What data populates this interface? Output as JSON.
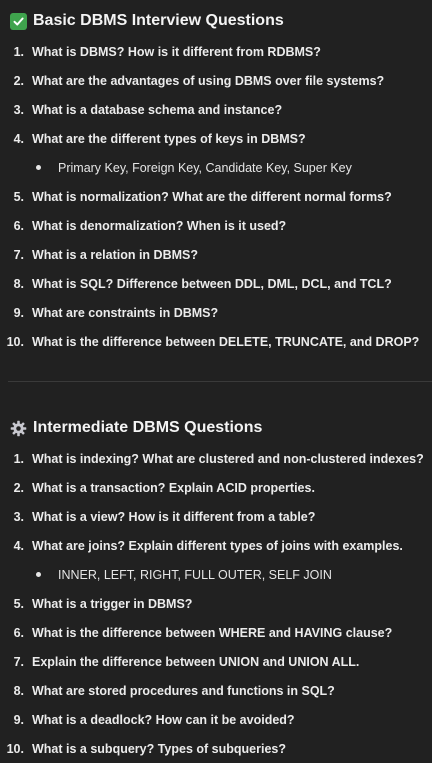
{
  "basic": {
    "title": "Basic DBMS Interview Questions",
    "icon": "check-mark-icon",
    "questions": [
      {
        "num": "1.",
        "text": "What is DBMS? How is it different from RDBMS?"
      },
      {
        "num": "2.",
        "text": "What are the advantages of using DBMS over file systems?"
      },
      {
        "num": "3.",
        "text": "What is a database schema and instance?"
      },
      {
        "num": "4.",
        "text": "What are the different types of keys in DBMS?"
      },
      {
        "num": "5.",
        "text": "What is normalization? What are the different normal forms?"
      },
      {
        "num": "6.",
        "text": "What is denormalization? When is it used?"
      },
      {
        "num": "7.",
        "text": "What is a relation in DBMS?"
      },
      {
        "num": "8.",
        "text": "What is SQL? Difference between DDL, DML, DCL, and TCL?"
      },
      {
        "num": "9.",
        "text": "What are constraints in DBMS?"
      },
      {
        "num": "10.",
        "text": "What is the difference between DELETE, TRUNCATE, and DROP?"
      }
    ],
    "subitem": "Primary Key, Foreign Key, Candidate Key, Super Key"
  },
  "intermediate": {
    "title": "Intermediate DBMS Questions",
    "icon": "gear-icon",
    "questions": [
      {
        "num": "1.",
        "text": "What is indexing? What are clustered and non-clustered indexes?"
      },
      {
        "num": "2.",
        "text": "What is a transaction? Explain ACID properties."
      },
      {
        "num": "3.",
        "text": "What is a view? How is it different from a table?"
      },
      {
        "num": "4.",
        "text": "What are joins? Explain different types of joins with examples."
      },
      {
        "num": "5.",
        "text": "What is a trigger in DBMS?"
      },
      {
        "num": "6.",
        "text": "What is the difference between WHERE and HAVING clause?"
      },
      {
        "num": "7.",
        "text": "Explain the difference between UNION and UNION ALL."
      },
      {
        "num": "8.",
        "text": "What are stored procedures and functions in SQL?"
      },
      {
        "num": "9.",
        "text": "What is a deadlock? How can it be avoided?"
      },
      {
        "num": "10.",
        "text": "What is a subquery? Types of subqueries?"
      }
    ],
    "subitem": "INNER, LEFT, RIGHT, FULL OUTER, SELF JOIN"
  },
  "colors": {
    "background": "#212121",
    "text": "#ececec",
    "check_green": "#3fa34d",
    "divider": "#3a3a3a"
  }
}
